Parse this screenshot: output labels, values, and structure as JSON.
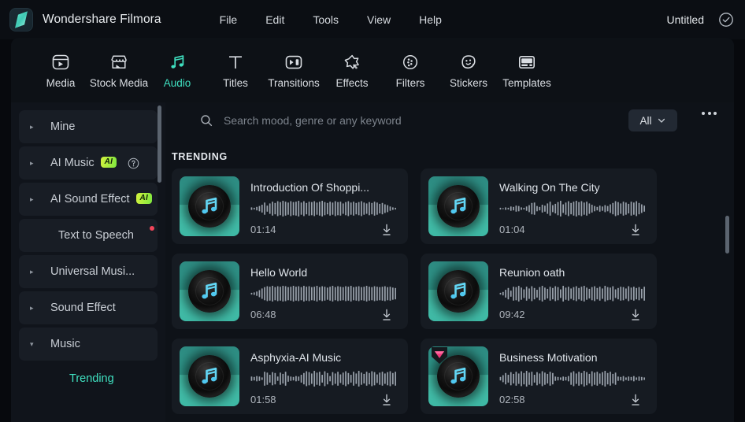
{
  "titlebar": {
    "logo_icon": "filmora-logo-icon",
    "app_title": "Wondershare Filmora",
    "menus": [
      "File",
      "Edit",
      "Tools",
      "View",
      "Help"
    ],
    "project_name": "Untitled",
    "status_icon": "check-circle-icon"
  },
  "toolbar": {
    "items": [
      {
        "label": "Media",
        "icon": "media-icon",
        "active": false
      },
      {
        "label": "Stock Media",
        "icon": "stock-media-icon",
        "active": false
      },
      {
        "label": "Audio",
        "icon": "audio-note-icon",
        "active": true
      },
      {
        "label": "Titles",
        "icon": "titles-text-icon",
        "active": false
      },
      {
        "label": "Transitions",
        "icon": "transitions-icon",
        "active": false
      },
      {
        "label": "Effects",
        "icon": "effects-wand-icon",
        "active": false
      },
      {
        "label": "Filters",
        "icon": "filters-circle-icon",
        "active": false
      },
      {
        "label": "Stickers",
        "icon": "stickers-face-icon",
        "active": false
      },
      {
        "label": "Templates",
        "icon": "templates-icon",
        "active": false
      }
    ],
    "active_label": "Audio",
    "accent_color": "#3fe0c0"
  },
  "sidebar": {
    "items": [
      {
        "label": "Mine",
        "caret": true,
        "badge": null,
        "help": false,
        "dot": false
      },
      {
        "label": "AI Music",
        "caret": true,
        "badge": "AI",
        "help": true,
        "dot": false
      },
      {
        "label": "AI Sound Effect",
        "caret": true,
        "badge": "AI",
        "help": false,
        "dot": false
      },
      {
        "label": "Text to Speech",
        "caret": false,
        "badge": null,
        "help": false,
        "dot": true
      },
      {
        "label": "Universal Musi...",
        "caret": true,
        "badge": null,
        "help": false,
        "dot": false
      },
      {
        "label": "Sound Effect",
        "caret": true,
        "badge": null,
        "help": false,
        "dot": false
      },
      {
        "label": "Music",
        "caret": true,
        "expanded": true,
        "badge": null,
        "help": false,
        "dot": false
      }
    ],
    "sub_items": [
      {
        "label": "Trending",
        "selected": true
      }
    ],
    "badge_color": "#9fe83f",
    "selected_color": "#3fe0c0"
  },
  "search": {
    "icon": "search-icon",
    "placeholder": "Search mood, genre or any keyword",
    "value": "",
    "filter_label": "All",
    "filter_caret_icon": "chevron-down-icon",
    "more_icon": "more-horizontal-icon"
  },
  "main": {
    "section_label": "TRENDING",
    "tracks": [
      {
        "title": "Introduction Of Shoppi...",
        "duration": "01:14",
        "premium": false,
        "download_icon": "download-icon",
        "wave": [
          3,
          2,
          4,
          6,
          9,
          14,
          7,
          12,
          16,
          13,
          17,
          15,
          18,
          16,
          14,
          17,
          15,
          16,
          18,
          14,
          17,
          13,
          16,
          15,
          17,
          14,
          16,
          18,
          15,
          13,
          16,
          14,
          17,
          15,
          16,
          12,
          15,
          17,
          14,
          16,
          13,
          15,
          17,
          14,
          12,
          15,
          13,
          16,
          14,
          11,
          13,
          10,
          8,
          5,
          3,
          2
        ]
      },
      {
        "title": "Walking On The City",
        "duration": "01:04",
        "premium": false,
        "download_icon": "download-icon",
        "wave": [
          2,
          1,
          3,
          2,
          5,
          4,
          7,
          6,
          3,
          2,
          5,
          8,
          13,
          14,
          6,
          4,
          9,
          7,
          12,
          16,
          8,
          11,
          15,
          18,
          10,
          14,
          17,
          13,
          16,
          18,
          15,
          17,
          14,
          16,
          12,
          9,
          6,
          4,
          7,
          5,
          8,
          6,
          10,
          13,
          17,
          15,
          12,
          16,
          14,
          11,
          16,
          14,
          17,
          13,
          10,
          7
        ]
      },
      {
        "title": "Hello World",
        "duration": "06:48",
        "premium": false,
        "download_icon": "download-icon",
        "wave": [
          2,
          3,
          5,
          8,
          12,
          15,
          17,
          16,
          18,
          15,
          17,
          16,
          18,
          17,
          15,
          16,
          18,
          16,
          17,
          15,
          18,
          16,
          17,
          15,
          16,
          18,
          15,
          17,
          16,
          14,
          16,
          18,
          15,
          17,
          16,
          15,
          17,
          16,
          18,
          15,
          16,
          17,
          15,
          16,
          18,
          16,
          15,
          17,
          16,
          15,
          16,
          17,
          15,
          16,
          14,
          13
        ]
      },
      {
        "title": "Reunion oath",
        "duration": "09:42",
        "premium": false,
        "download_icon": "download-icon",
        "wave": [
          2,
          4,
          9,
          13,
          7,
          16,
          15,
          18,
          14,
          10,
          16,
          12,
          17,
          13,
          9,
          15,
          18,
          14,
          11,
          16,
          13,
          17,
          15,
          10,
          18,
          14,
          16,
          12,
          15,
          17,
          13,
          16,
          18,
          14,
          11,
          15,
          17,
          13,
          16,
          12,
          18,
          15,
          14,
          17,
          10,
          13,
          16,
          15,
          12,
          17,
          14,
          16,
          13,
          15,
          11,
          16
        ]
      },
      {
        "title": "Asphyxia-AI Music",
        "duration": "01:58",
        "premium": false,
        "download_icon": "download-icon",
        "wave": [
          5,
          4,
          6,
          5,
          3,
          16,
          14,
          9,
          15,
          13,
          5,
          14,
          11,
          16,
          7,
          5,
          4,
          6,
          5,
          9,
          13,
          17,
          15,
          12,
          18,
          14,
          16,
          9,
          17,
          13,
          6,
          15,
          12,
          16,
          10,
          14,
          17,
          13,
          9,
          16,
          12,
          18,
          14,
          11,
          16,
          13,
          17,
          15,
          10,
          14,
          16,
          12,
          15,
          17,
          13,
          16
        ]
      },
      {
        "title": "Business Motivation",
        "duration": "02:58",
        "premium": true,
        "premium_icon": "premium-gem-icon",
        "download_icon": "download-icon",
        "wave": [
          4,
          8,
          13,
          9,
          15,
          11,
          16,
          12,
          17,
          13,
          18,
          14,
          16,
          9,
          15,
          12,
          17,
          14,
          11,
          16,
          13,
          5,
          4,
          3,
          5,
          4,
          6,
          14,
          17,
          12,
          16,
          13,
          18,
          15,
          11,
          17,
          14,
          16,
          12,
          15,
          18,
          13,
          16,
          11,
          14,
          5,
          4,
          6,
          3,
          5,
          4,
          6,
          3,
          5,
          4,
          3
        ]
      }
    ]
  },
  "scrollbars": {
    "sidebar": "sidebar-scrollbar",
    "content": "content-scrollbar"
  }
}
